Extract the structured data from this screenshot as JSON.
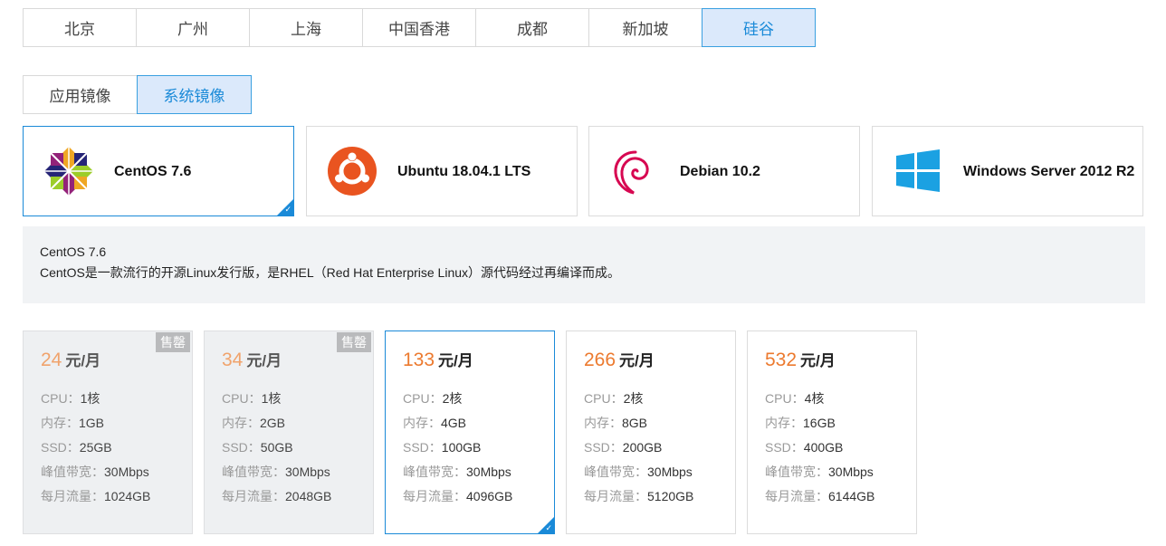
{
  "regions": [
    "北京",
    "广州",
    "上海",
    "中国香港",
    "成都",
    "新加坡",
    "硅谷"
  ],
  "active_region": "硅谷",
  "image_types": [
    "应用镜像",
    "系统镜像"
  ],
  "active_image_type": "系统镜像",
  "os_options": [
    {
      "name": "CentOS 7.6",
      "icon": "centos-logo-icon"
    },
    {
      "name": "Ubuntu 18.04.1 LTS",
      "icon": "ubuntu-logo-icon"
    },
    {
      "name": "Debian 10.2",
      "icon": "debian-logo-icon"
    },
    {
      "name": "Windows Server 2012 R2",
      "icon": "windows-logo-icon"
    }
  ],
  "selected_os": "CentOS 7.6",
  "description": {
    "title": "CentOS 7.6",
    "text": "CentOS是一款流行的开源Linux发行版，是RHEL（Red Hat Enterprise Linux）源代码经过再编译而成。"
  },
  "spec_labels": {
    "cpu": "CPU：",
    "ram": "内存：",
    "ssd": "SSD：",
    "bandwidth": "峰值带宽：",
    "traffic": "每月流量："
  },
  "price_unit": "元/月",
  "sold_out_label": "售罄",
  "plans": [
    {
      "price": "24",
      "cpu": "1核",
      "ram": "1GB",
      "ssd": "25GB",
      "bandwidth": "30Mbps",
      "traffic": "1024GB",
      "sold_out": true
    },
    {
      "price": "34",
      "cpu": "1核",
      "ram": "2GB",
      "ssd": "50GB",
      "bandwidth": "30Mbps",
      "traffic": "2048GB",
      "sold_out": true
    },
    {
      "price": "133",
      "cpu": "2核",
      "ram": "4GB",
      "ssd": "100GB",
      "bandwidth": "30Mbps",
      "traffic": "4096GB",
      "sold_out": false
    },
    {
      "price": "266",
      "cpu": "2核",
      "ram": "8GB",
      "ssd": "200GB",
      "bandwidth": "30Mbps",
      "traffic": "5120GB",
      "sold_out": false
    },
    {
      "price": "532",
      "cpu": "4核",
      "ram": "16GB",
      "ssd": "400GB",
      "bandwidth": "30Mbps",
      "traffic": "6144GB",
      "sold_out": false
    }
  ],
  "selected_plan_price": "133",
  "colors": {
    "accent": "#1a8ad8",
    "active_bg": "#dbe9fb",
    "price": "#ec7a2f",
    "soldout_bg": "#eef0f2"
  }
}
